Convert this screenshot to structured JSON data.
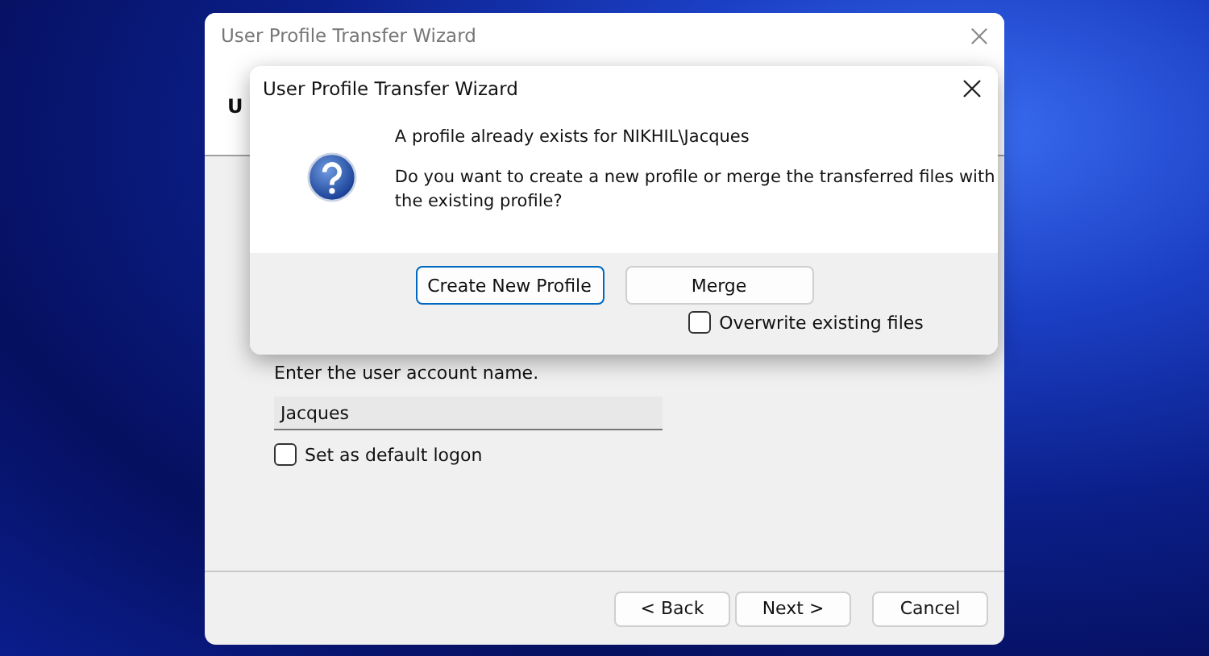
{
  "wizard": {
    "title": "User Profile Transfer Wizard",
    "heading": "U",
    "prompt": "Enter the user account name.",
    "account_name": "Jacques",
    "default_logon": {
      "label": "Set as default logon",
      "checked": false
    },
    "buttons": [
      {
        "label": "< Back"
      },
      {
        "label": "Next >"
      },
      {
        "label": "Cancel"
      }
    ]
  },
  "dialog": {
    "title": "User Profile Transfer Wizard",
    "message": "A profile already exists for NIKHIL\\Jacques",
    "question": "Do you want to create a new profile or merge the transferred files with the existing profile?",
    "buttons": [
      {
        "label": "Create New Profile",
        "kind": "default"
      },
      {
        "label": "Merge",
        "kind": "normal"
      }
    ],
    "overwrite": {
      "label": "Overwrite existing files",
      "checked": false
    }
  }
}
